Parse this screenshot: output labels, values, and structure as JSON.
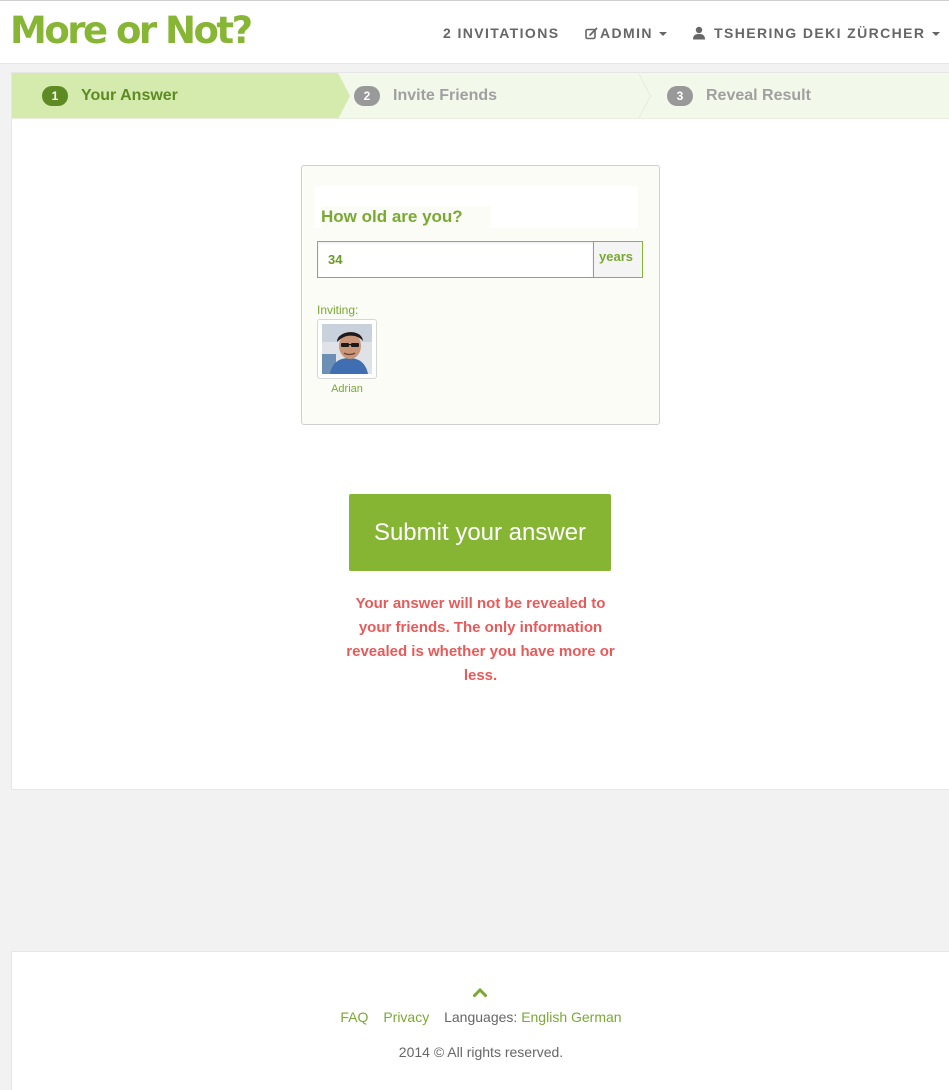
{
  "brand": {
    "logo_text": "More or Not?"
  },
  "nav": {
    "invitations_label": "2 INVITATIONS",
    "admin_label": "ADMIN",
    "user_label": "TSHERING DEKI ZÜRCHER"
  },
  "steps": [
    {
      "number": "1",
      "label": "Your Answer"
    },
    {
      "number": "2",
      "label": "Invite Friends"
    },
    {
      "number": "3",
      "label": "Reveal Result"
    }
  ],
  "question": {
    "text": "How old are you?",
    "answer_value": "34",
    "unit": "years"
  },
  "inviting": {
    "label": "Inviting:",
    "friends": [
      {
        "name": "Adrian"
      }
    ]
  },
  "submit_label": "Submit your answer",
  "privacy_note": "Your answer will not be revealed to your friends. The only information revealed is whether you have more or less.",
  "footer": {
    "faq": "FAQ",
    "privacy": "Privacy",
    "languages_label": "Languages:",
    "lang_english": "English",
    "lang_german": "German",
    "copyright": "2014 © All rights reserved."
  },
  "colors": {
    "accent": "#86b534",
    "warning": "#e85a5a",
    "step_active_bg": "#d5ebad"
  }
}
